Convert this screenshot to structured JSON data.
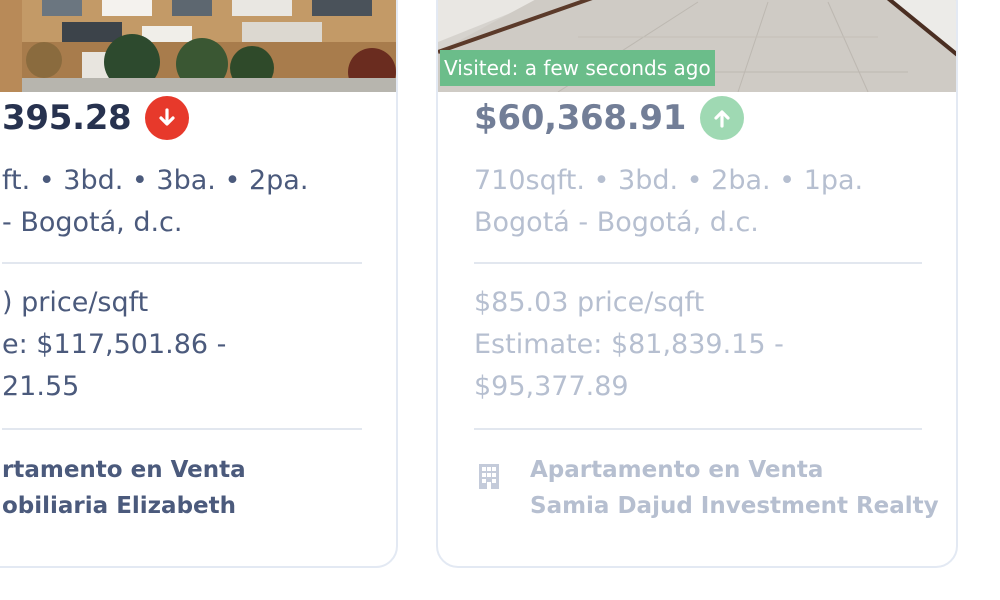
{
  "colors": {
    "price_text": "#27324f",
    "body_text": "#4b5a7c",
    "faded_text": "#b6bfd0",
    "trend_down": "#e7392b",
    "trend_up": "#9fd9b3",
    "visited_badge": "#6bbd8a",
    "card_border": "#e3e9f3"
  },
  "listings": [
    {
      "price": "395.28",
      "trend_icon": "arrow-down-icon",
      "specs_line1": "ft. • 3bd. • 3ba. • 2pa.",
      "specs_line2": "- Bogotá, d.c.",
      "price_per_sqft": ") price/sqft",
      "estimate_line1": "e: $117,501.86 -",
      "estimate_line2": "21.55",
      "agency_line1": "rtamento en Venta",
      "agency_line2": "obiliaria Elizabeth"
    },
    {
      "price": "$60,368.91",
      "trend_icon": "arrow-up-icon",
      "visited": "Visited: a few seconds ago",
      "specs_line1": "710sqft. • 3bd. • 2ba. • 1pa.",
      "specs_line2": "Bogotá - Bogotá, d.c.",
      "price_per_sqft": "$85.03 price/sqft",
      "estimate_line1": "Estimate: $81,839.15 -",
      "estimate_line2": "$95,377.89",
      "agency_icon": "building-icon",
      "agency_line1": "Apartamento en Venta",
      "agency_line2": "Samia Dajud Investment Realty"
    }
  ]
}
